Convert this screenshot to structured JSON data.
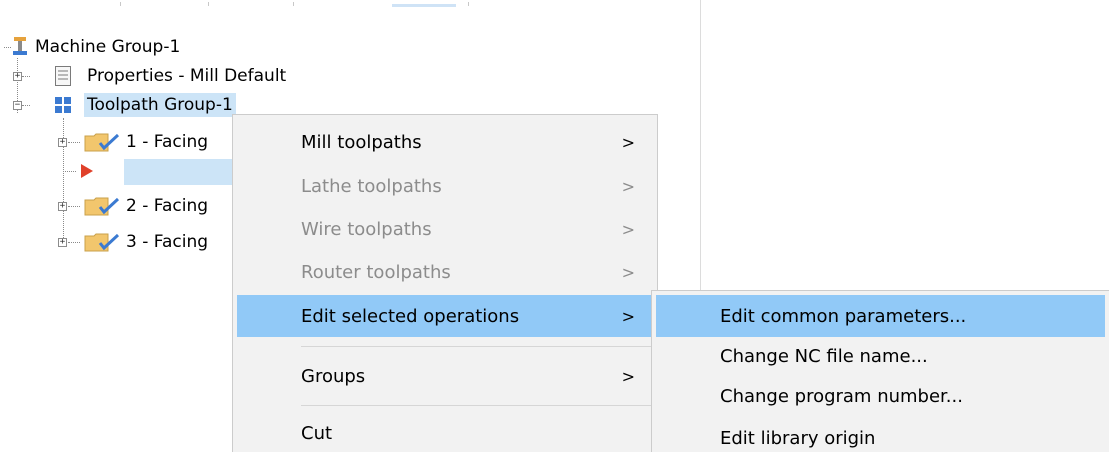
{
  "tree": {
    "machine_group": "Machine Group-1",
    "properties": "Properties - Mill Default",
    "toolpath_group": "Toolpath Group-1",
    "op1": "1 - Facing",
    "op2": "2 - Facing",
    "op3": "3 - Facing"
  },
  "context_menu": {
    "mill_toolpaths": "Mill toolpaths",
    "lathe_toolpaths": "Lathe toolpaths",
    "wire_toolpaths": "Wire toolpaths",
    "router_toolpaths": "Router toolpaths",
    "edit_selected_operations": "Edit selected operations",
    "groups": "Groups",
    "cut": "Cut",
    "submenu_arrow": ">"
  },
  "submenu": {
    "edit_common_parameters": "Edit common parameters...",
    "change_nc_file_name": "Change NC file name...",
    "change_program_number": "Change program number...",
    "edit_library_origin": "Edit library origin"
  },
  "colors": {
    "selection": "#cce4f7",
    "menu_hover": "#91c9f7",
    "menu_bg": "#f2f2f2",
    "disabled_text": "#8c8c8c",
    "play_marker": "#e0412a",
    "folder": "#f2c66d",
    "check": "#3b7ad1"
  }
}
